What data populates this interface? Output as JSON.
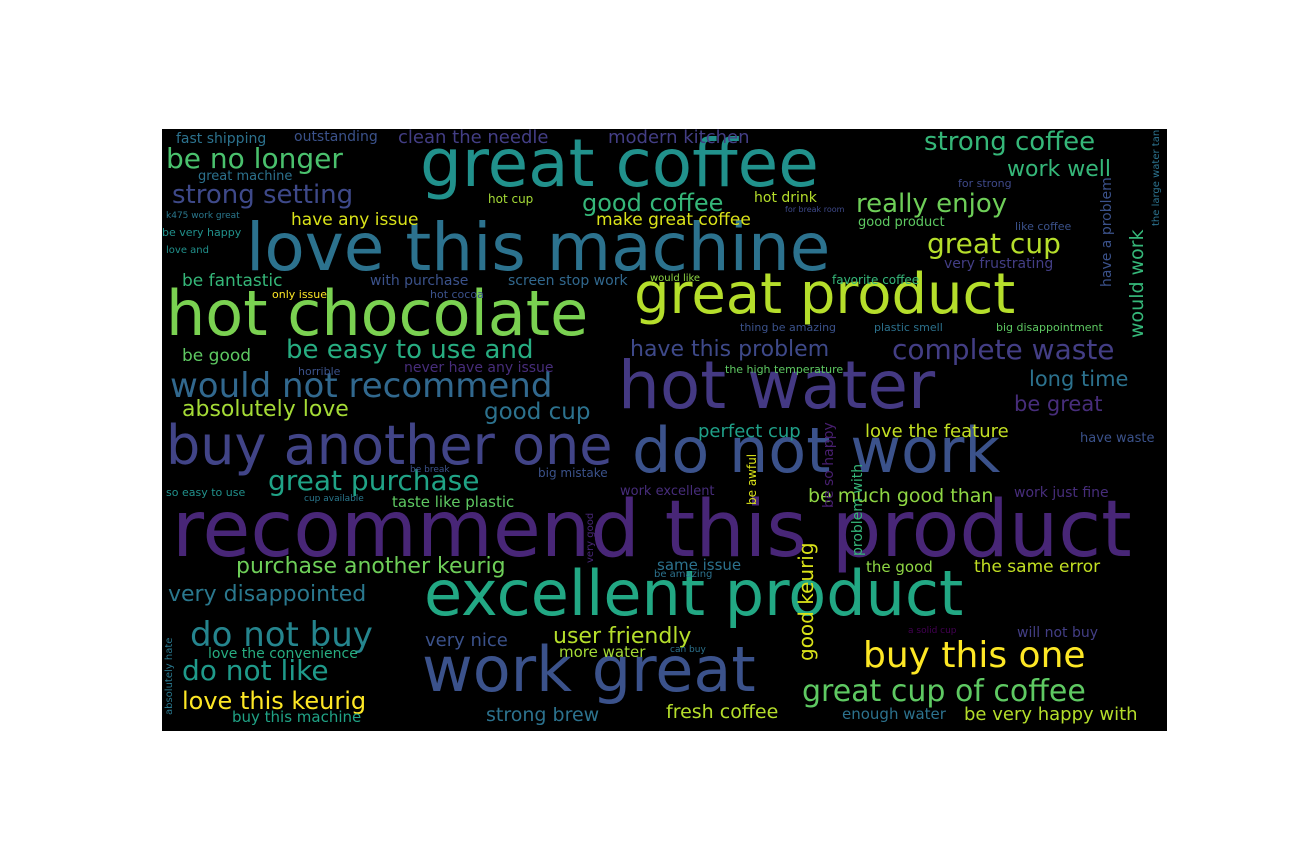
{
  "words": [
    {
      "text": "great coffee",
      "color": "#21918c"
    },
    {
      "text": "love this machine",
      "color": "#2c728e"
    },
    {
      "text": "hot chocolate",
      "color": "#7ad151"
    },
    {
      "text": "great product",
      "color": "#b5de2b"
    },
    {
      "text": "hot water",
      "color": "#443983"
    },
    {
      "text": "do not work",
      "color": "#3b528b"
    },
    {
      "text": "buy another one",
      "color": "#414487"
    },
    {
      "text": "recommend this product",
      "color": "#482677"
    },
    {
      "text": "excellent product",
      "color": "#22a884"
    },
    {
      "text": "work great",
      "color": "#3b528b"
    },
    {
      "text": "strong coffee",
      "color": "#35b779"
    },
    {
      "text": "be no longer",
      "color": "#4ac16d"
    },
    {
      "text": "strong setting",
      "color": "#3e4989"
    },
    {
      "text": "work well",
      "color": "#35b779"
    },
    {
      "text": "good coffee",
      "color": "#35b779"
    },
    {
      "text": "really enjoy",
      "color": "#6ece58"
    },
    {
      "text": "great cup",
      "color": "#b5de2b"
    },
    {
      "text": "be easy to use and",
      "color": "#27ad81"
    },
    {
      "text": "have this problem",
      "color": "#3e4989"
    },
    {
      "text": "complete waste",
      "color": "#433e85"
    },
    {
      "text": "would not recommend",
      "color": "#31688e"
    },
    {
      "text": "long time",
      "color": "#2c728e"
    },
    {
      "text": "absolutely love",
      "color": "#a5db36"
    },
    {
      "text": "good cup",
      "color": "#2c728e"
    },
    {
      "text": "be great",
      "color": "#472d7b"
    },
    {
      "text": "great purchase",
      "color": "#20a386"
    },
    {
      "text": "love the feature",
      "color": "#c2df23"
    },
    {
      "text": "perfect cup",
      "color": "#1fa088"
    },
    {
      "text": "be much good than",
      "color": "#8fd744"
    },
    {
      "text": "purchase another keurig",
      "color": "#6ece58"
    },
    {
      "text": "very disappointed",
      "color": "#2a788e"
    },
    {
      "text": "do not buy",
      "color": "#25858e"
    },
    {
      "text": "buy this one",
      "color": "#fde725"
    },
    {
      "text": "great cup of coffee",
      "color": "#5ec962"
    },
    {
      "text": "do not like",
      "color": "#1f9a8a"
    },
    {
      "text": "love this keurig",
      "color": "#fde725"
    },
    {
      "text": "user friendly",
      "color": "#b5de2b"
    },
    {
      "text": "very nice",
      "color": "#3b528b"
    },
    {
      "text": "fresh coffee",
      "color": "#b5de2b"
    },
    {
      "text": "strong brew",
      "color": "#2c728e"
    },
    {
      "text": "be very happy with",
      "color": "#b5de2b"
    },
    {
      "text": "buy this machine",
      "color": "#20a386"
    },
    {
      "text": "enough water",
      "color": "#2c728e"
    },
    {
      "text": "more water",
      "color": "#a5db36"
    },
    {
      "text": "the same error",
      "color": "#c2df23"
    },
    {
      "text": "the good",
      "color": "#8fd744"
    },
    {
      "text": "same issue",
      "color": "#2c728e"
    },
    {
      "text": "be fantastic",
      "color": "#35b779"
    },
    {
      "text": "be good",
      "color": "#5ec962"
    },
    {
      "text": "have any issue",
      "color": "#dae319"
    },
    {
      "text": "make great coffee",
      "color": "#dae319"
    },
    {
      "text": "clean the needle",
      "color": "#433e85"
    },
    {
      "text": "modern kitchen",
      "color": "#433e85"
    },
    {
      "text": "fast shipping",
      "color": "#2c728e"
    },
    {
      "text": "outstanding",
      "color": "#3b528b"
    },
    {
      "text": "great machine",
      "color": "#2c728e"
    },
    {
      "text": "hot drink",
      "color": "#b5de2b"
    },
    {
      "text": "hot cup",
      "color": "#a5db36"
    },
    {
      "text": "good product",
      "color": "#5ec962"
    },
    {
      "text": "for strong",
      "color": "#3e4989"
    },
    {
      "text": "for break room",
      "color": "#3e4989"
    },
    {
      "text": "like coffee",
      "color": "#3b528b"
    },
    {
      "text": "k475 work great",
      "color": "#2a788e"
    },
    {
      "text": "be very happy",
      "color": "#21918c"
    },
    {
      "text": "love and",
      "color": "#21918c"
    },
    {
      "text": "very frustrating",
      "color": "#433e85"
    },
    {
      "text": "favorite coffee",
      "color": "#35b779"
    },
    {
      "text": "would like",
      "color": "#8fd744"
    },
    {
      "text": "with purchase",
      "color": "#3b528b"
    },
    {
      "text": "screen stop work",
      "color": "#31688e"
    },
    {
      "text": "only issue",
      "color": "#fde725"
    },
    {
      "text": "hot cocoa",
      "color": "#3b528b"
    },
    {
      "text": "thing be amazing",
      "color": "#3b528b"
    },
    {
      "text": "plastic smell",
      "color": "#2c728e"
    },
    {
      "text": "big disappointment",
      "color": "#5ec962"
    },
    {
      "text": "never have any issue",
      "color": "#472d7b"
    },
    {
      "text": "horrible",
      "color": "#3b528b"
    },
    {
      "text": "the high temperature",
      "color": "#5ec962"
    },
    {
      "text": "have waste",
      "color": "#3b528b"
    },
    {
      "text": "be break",
      "color": "#3b528b"
    },
    {
      "text": "big mistake",
      "color": "#3b528b"
    },
    {
      "text": "work excellent",
      "color": "#472d7b"
    },
    {
      "text": "work just fine",
      "color": "#472d7b"
    },
    {
      "text": "so easy to use",
      "color": "#21918c"
    },
    {
      "text": "cup available",
      "color": "#2a788e"
    },
    {
      "text": "taste like plastic",
      "color": "#5ec962"
    },
    {
      "text": "be amazing",
      "color": "#2c728e"
    },
    {
      "text": "a solid cup",
      "color": "#440154"
    },
    {
      "text": "will not buy",
      "color": "#433e85"
    },
    {
      "text": "can buy",
      "color": "#2c728e"
    },
    {
      "text": "love the convenience",
      "color": "#27ad81"
    },
    {
      "text": "absolutely hate",
      "color": "#2a788e"
    },
    {
      "text": "very good",
      "color": "#482677"
    },
    {
      "text": "be awful",
      "color": "#dae319"
    },
    {
      "text": "be so happy",
      "color": "#481f70"
    },
    {
      "text": "problem with",
      "color": "#35b779"
    },
    {
      "text": "good keurig",
      "color": "#dae319"
    },
    {
      "text": "have a problem",
      "color": "#3b528b"
    },
    {
      "text": "would work",
      "color": "#35b779"
    },
    {
      "text": "the large water tank",
      "color": "#2c728e"
    }
  ]
}
